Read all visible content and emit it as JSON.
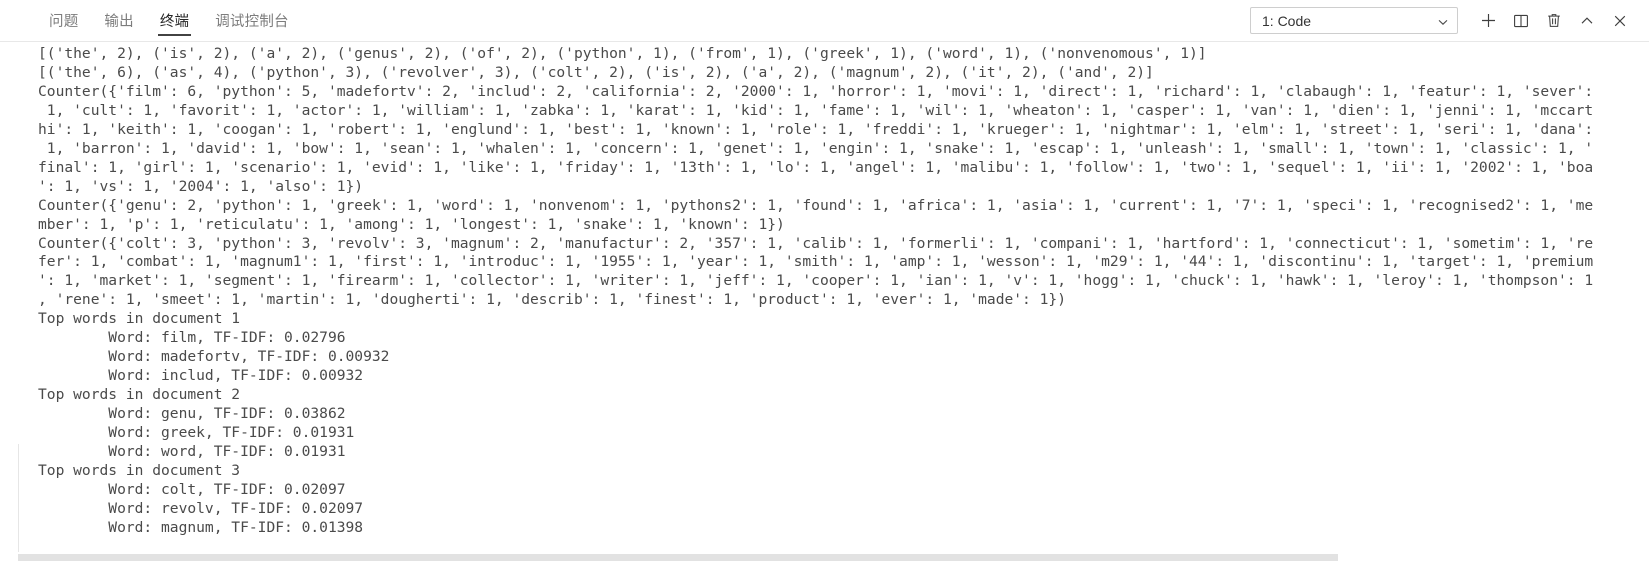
{
  "panel": {
    "tabs": [
      {
        "label": "问题",
        "name": "tab-problems",
        "active": false
      },
      {
        "label": "输出",
        "name": "tab-output",
        "active": false
      },
      {
        "label": "终端",
        "name": "tab-terminal",
        "active": true
      },
      {
        "label": "调试控制台",
        "name": "tab-debug-console",
        "active": false
      }
    ],
    "terminal_selector": {
      "value": "1: Code",
      "chevron_icon": "chevron-down-icon"
    },
    "actions": [
      {
        "name": "new-terminal-button",
        "icon": "plus-icon",
        "title": "新建终端"
      },
      {
        "name": "split-terminal-button",
        "icon": "split-panel-icon",
        "title": "拆分终端"
      },
      {
        "name": "kill-terminal-button",
        "icon": "trash-icon",
        "title": "终止终端"
      },
      {
        "name": "maximize-panel-button",
        "icon": "chevron-up-icon",
        "title": "最大化面板"
      },
      {
        "name": "close-panel-button",
        "icon": "close-icon",
        "title": "关闭面板"
      }
    ]
  },
  "terminal": {
    "font_color": "#4a4a4a",
    "background": "#ffffff",
    "output": "[('the', 2), ('is', 2), ('a', 2), ('genus', 2), ('of', 2), ('python', 1), ('from', 1), ('greek', 1), ('word', 1), ('nonvenomous', 1)]\n[('the', 6), ('as', 4), ('python', 3), ('revolver', 3), ('colt', 2), ('is', 2), ('a', 2), ('magnum', 2), ('it', 2), ('and', 2)]\nCounter({'film': 6, 'python': 5, 'madefortv': 2, 'includ': 2, 'california': 2, '2000': 1, 'horror': 1, 'movi': 1, 'direct': 1, 'richard': 1, 'clabaugh': 1, 'featur': 1, 'sever':\n 1, 'cult': 1, 'favorit': 1, 'actor': 1, 'william': 1, 'zabka': 1, 'karat': 1, 'kid': 1, 'fame': 1, 'wil': 1, 'wheaton': 1, 'casper': 1, 'van': 1, 'dien': 1, 'jenni': 1, 'mccart\nhi': 1, 'keith': 1, 'coogan': 1, 'robert': 1, 'englund': 1, 'best': 1, 'known': 1, 'role': 1, 'freddi': 1, 'krueger': 1, 'nightmar': 1, 'elm': 1, 'street': 1, 'seri': 1, 'dana':\n 1, 'barron': 1, 'david': 1, 'bow': 1, 'sean': 1, 'whalen': 1, 'concern': 1, 'genet': 1, 'engin': 1, 'snake': 1, 'escap': 1, 'unleash': 1, 'small': 1, 'town': 1, 'classic': 1, '\nfinal': 1, 'girl': 1, 'scenario': 1, 'evid': 1, 'like': 1, 'friday': 1, '13th': 1, 'lo': 1, 'angel': 1, 'malibu': 1, 'follow': 1, 'two': 1, 'sequel': 1, 'ii': 1, '2002': 1, 'boa\n': 1, 'vs': 1, '2004': 1, 'also': 1})\nCounter({'genu': 2, 'python': 1, 'greek': 1, 'word': 1, 'nonvenom': 1, 'pythons2': 1, 'found': 1, 'africa': 1, 'asia': 1, 'current': 1, '7': 1, 'speci': 1, 'recognised2': 1, 'me\nmber': 1, 'p': 1, 'reticulatu': 1, 'among': 1, 'longest': 1, 'snake': 1, 'known': 1})\nCounter({'colt': 3, 'python': 3, 'revolv': 3, 'magnum': 2, 'manufactur': 2, '357': 1, 'calib': 1, 'formerli': 1, 'compani': 1, 'hartford': 1, 'connecticut': 1, 'sometim': 1, 're\nfer': 1, 'combat': 1, 'magnum1': 1, 'first': 1, 'introduc': 1, '1955': 1, 'year': 1, 'smith': 1, 'amp': 1, 'wesson': 1, 'm29': 1, '44': 1, 'discontinu': 1, 'target': 1, 'premium\n': 1, 'market': 1, 'segment': 1, 'firearm': 1, 'collector': 1, 'writer': 1, 'jeff': 1, 'cooper': 1, 'ian': 1, 'v': 1, 'hogg': 1, 'chuck': 1, 'hawk': 1, 'leroy': 1, 'thompson': 1\n, 'rene': 1, 'smeet': 1, 'martin': 1, 'dougherti': 1, 'describ': 1, 'finest': 1, 'product': 1, 'ever': 1, 'made': 1})\nTop words in document 1\n        Word: film, TF-IDF: 0.02796\n        Word: madefortv, TF-IDF: 0.00932\n        Word: includ, TF-IDF: 0.00932\nTop words in document 2\n        Word: genu, TF-IDF: 0.03862\n        Word: greek, TF-IDF: 0.01931\n        Word: word, TF-IDF: 0.01931\nTop words in document 3\n        Word: colt, TF-IDF: 0.02097\n        Word: revolv, TF-IDF: 0.02097\n        Word: magnum, TF-IDF: 0.01398"
  }
}
